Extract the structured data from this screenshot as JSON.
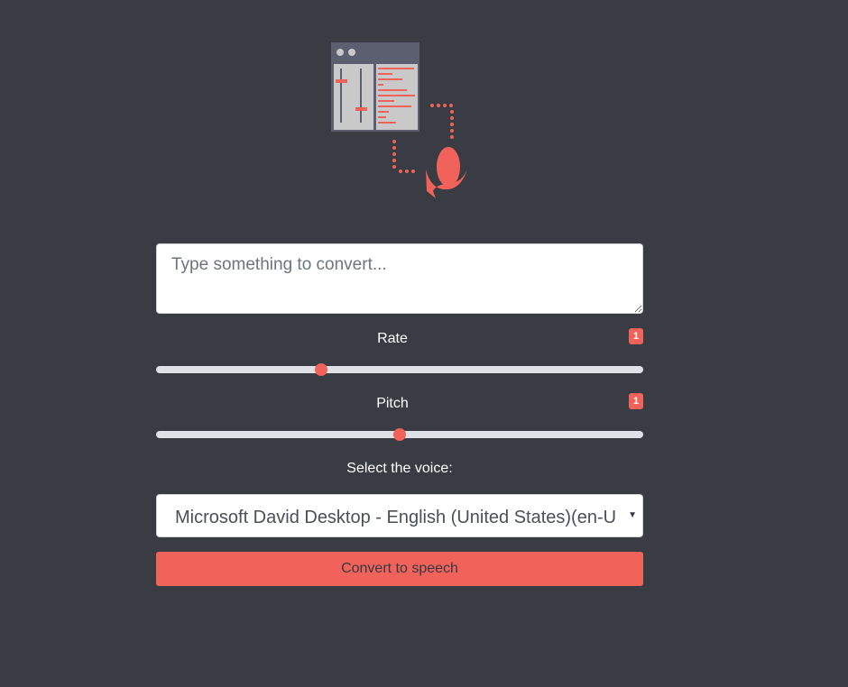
{
  "logo": {
    "icon": "text-to-speech-icon",
    "colors": {
      "accent": "#f1635a",
      "window_frame": "#5c5f70",
      "window_body": "#c9c9c9"
    }
  },
  "text_input": {
    "placeholder": "Type something to convert...",
    "value": ""
  },
  "rate": {
    "label": "Rate",
    "badge": "1",
    "fraction": 0.339
  },
  "pitch": {
    "label": "Pitch",
    "badge": "1",
    "fraction": 0.5
  },
  "voice": {
    "label": "Select the voice:",
    "selected": "Microsoft David Desktop - English (United States)(en-US)"
  },
  "convert_button": {
    "label": "Convert to speech"
  },
  "colors": {
    "background": "#393c43",
    "accent": "#f1635a",
    "track": "#dee2e6"
  }
}
